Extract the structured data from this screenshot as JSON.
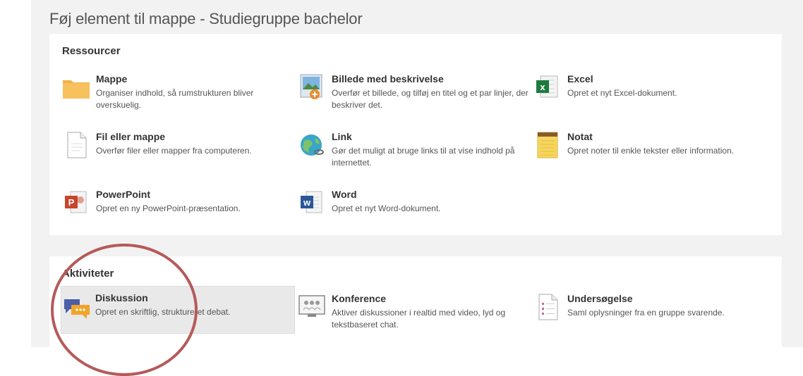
{
  "dialog": {
    "title": "Føj element til mappe - Studiegruppe bachelor"
  },
  "resources": {
    "heading": "Ressourcer",
    "items": [
      {
        "name": "Mappe",
        "desc": "Organiser indhold, så rumstrukturen bliver overskuelig.",
        "icon": "folder-icon"
      },
      {
        "name": "Billede med beskrivelse",
        "desc": "Overfør et billede, og tilføj en titel og et par linjer, der beskriver det.",
        "icon": "image-upload-icon"
      },
      {
        "name": "Excel",
        "desc": "Opret et nyt Excel-dokument.",
        "icon": "excel-icon"
      },
      {
        "name": "Fil eller mappe",
        "desc": "Overfør filer eller mapper fra computeren.",
        "icon": "file-icon"
      },
      {
        "name": "Link",
        "desc": "Gør det muligt at bruge links til at vise indhold på internettet.",
        "icon": "link-globe-icon"
      },
      {
        "name": "Notat",
        "desc": "Opret noter til enkle tekster eller information.",
        "icon": "notepad-icon"
      },
      {
        "name": "PowerPoint",
        "desc": "Opret en ny PowerPoint-præsentation.",
        "icon": "powerpoint-icon"
      },
      {
        "name": "Word",
        "desc": "Opret et nyt Word-dokument.",
        "icon": "word-icon"
      }
    ]
  },
  "activities": {
    "heading": "Aktiviteter",
    "items": [
      {
        "name": "Diskussion",
        "desc": "Opret en skriftlig, struktureret debat.",
        "icon": "discussion-icon"
      },
      {
        "name": "Konference",
        "desc": "Aktiver diskussioner i realtid med video, lyd og tekstbaseret chat.",
        "icon": "conference-icon"
      },
      {
        "name": "Undersøgelse",
        "desc": "Saml oplysninger fra en gruppe svarende.",
        "icon": "survey-icon"
      }
    ]
  },
  "colors": {
    "highlight_circle": "#b55a59",
    "selected_item_bg": "#e9e9e9"
  }
}
